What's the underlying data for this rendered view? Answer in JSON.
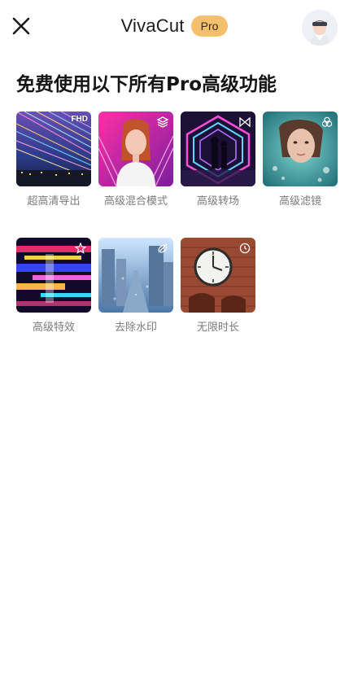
{
  "header": {
    "title": "VivaCut",
    "badge": "Pro",
    "close_icon": "close-icon",
    "avatar_icon": "user-avatar-icon"
  },
  "section": {
    "title": "免费使用以下所有Pro高级功能"
  },
  "features": [
    {
      "label": "超高清导出",
      "corner": "FHD",
      "icon": "fhd-text"
    },
    {
      "label": "高级混合模式",
      "icon": "layers-icon"
    },
    {
      "label": "高级转场",
      "icon": "bowtie-transition-icon"
    },
    {
      "label": "高级滤镜",
      "icon": "three-circles-icon"
    },
    {
      "label": "高级特效",
      "icon": "sparkle-star-icon"
    },
    {
      "label": "去除水印",
      "icon": "no-watermark-icon"
    },
    {
      "label": "无限时长",
      "icon": "clock-icon"
    }
  ],
  "colors": {
    "badge_bg": "#f4c06d",
    "label_gray": "#7b7b7b"
  }
}
